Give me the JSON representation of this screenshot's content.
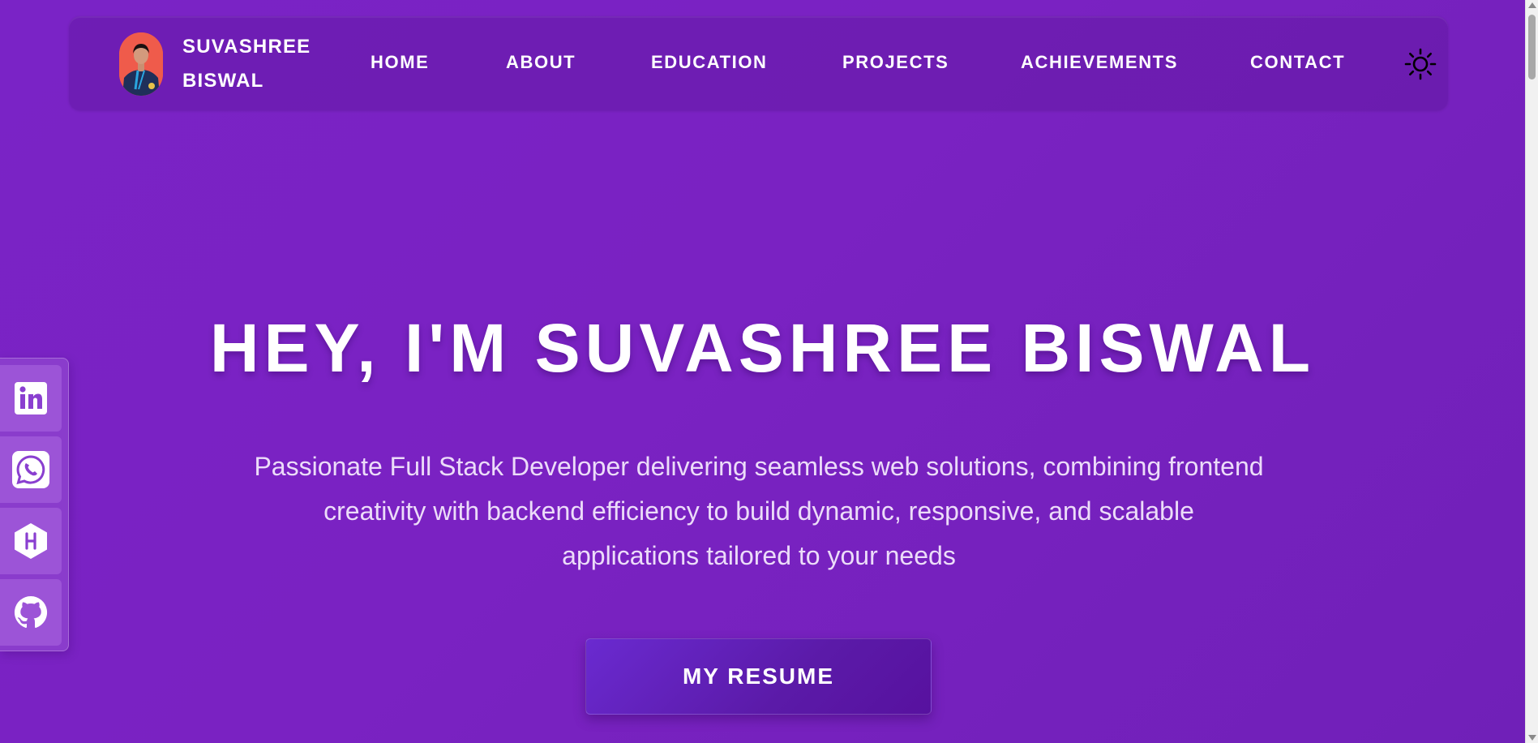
{
  "brand": {
    "name_line1": "SUVASHREE",
    "name_line2": "BISWAL",
    "avatar_icon": "profile-photo"
  },
  "nav": {
    "items": [
      {
        "label": "HOME"
      },
      {
        "label": "ABOUT"
      },
      {
        "label": "EDUCATION"
      },
      {
        "label": "PROJECTS"
      },
      {
        "label": "ACHIEVEMENTS"
      },
      {
        "label": "CONTACT"
      }
    ],
    "theme_toggle_icon": "sun-icon"
  },
  "hero": {
    "title": "HEY, I'M SUVASHREE BISWAL",
    "subtitle_line1": "Passionate Full Stack Developer delivering seamless web solutions, combining frontend",
    "subtitle_line2": "creativity with backend efficiency to build dynamic, responsive, and scalable",
    "subtitle_line3": "applications tailored to your needs",
    "resume_button": "MY RESUME"
  },
  "social": {
    "items": [
      {
        "icon": "linkedin-icon"
      },
      {
        "icon": "whatsapp-icon"
      },
      {
        "icon": "hashnode-icon"
      },
      {
        "icon": "github-icon"
      }
    ]
  },
  "colors": {
    "background": "#7a23c6",
    "accent": "#5b1aa8",
    "text": "#ffffff",
    "subtitle": "#ecdcf9"
  }
}
